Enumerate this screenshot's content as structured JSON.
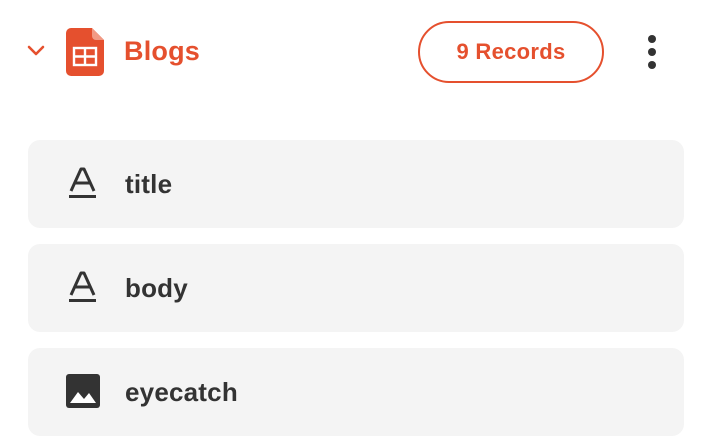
{
  "collection": {
    "name": "Blogs",
    "records_label": "9 Records",
    "accent_color": "#e5502e",
    "icon": "spreadsheet-icon",
    "expanded": true
  },
  "fields": [
    {
      "label": "title",
      "type_icon": "text-type-icon"
    },
    {
      "label": "body",
      "type_icon": "text-type-icon"
    },
    {
      "label": "eyecatch",
      "type_icon": "image-type-icon"
    }
  ]
}
